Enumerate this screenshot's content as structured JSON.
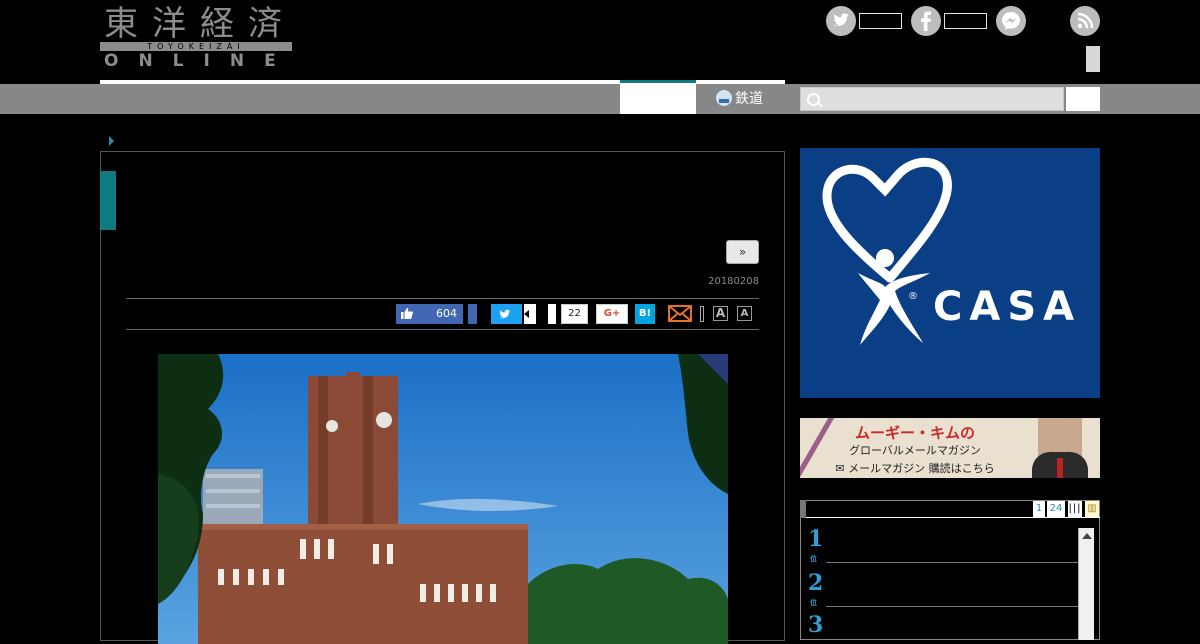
{
  "header": {
    "logo": {
      "kanji": "東洋経済",
      "roman": "TOYOKEIZAI",
      "online": "ONLINE"
    },
    "social": [
      {
        "icon": "twitter-icon",
        "color": "#bdbdbd"
      },
      {
        "icon": "facebook-icon",
        "color": "#bdbdbd"
      },
      {
        "icon": "messenger-icon",
        "color": "#bdbdbd"
      },
      {
        "icon": "rss-icon",
        "color": "#bdbdbd"
      }
    ]
  },
  "nav": {
    "active_color": "#0f7a82",
    "rail_label": "鉄道",
    "search": {
      "placeholder": ""
    }
  },
  "article": {
    "next_label": "»",
    "date": "20180208",
    "share": {
      "like_count": "604",
      "hatena_count": "22",
      "gplus_label": "G+",
      "hatena_label": "B!",
      "font_small": "A",
      "font_large": "A"
    },
    "photo": {
      "subject": "university clock tower under blue sky"
    }
  },
  "sidebar": {
    "ad_casa": {
      "brand": "CASA",
      "mark": "®",
      "bg": "#0b3f85"
    },
    "ad_mug": {
      "title": "ムーギー・キムの",
      "subtitle": "グローバルメールマガジン",
      "cta": "✉ メールマガジン 購読はこちら"
    },
    "ranking": {
      "pages": [
        "1",
        "24"
      ],
      "extra": "|||",
      "ranks": [
        "1",
        "2",
        "3"
      ],
      "rank_suffix": "位"
    }
  }
}
